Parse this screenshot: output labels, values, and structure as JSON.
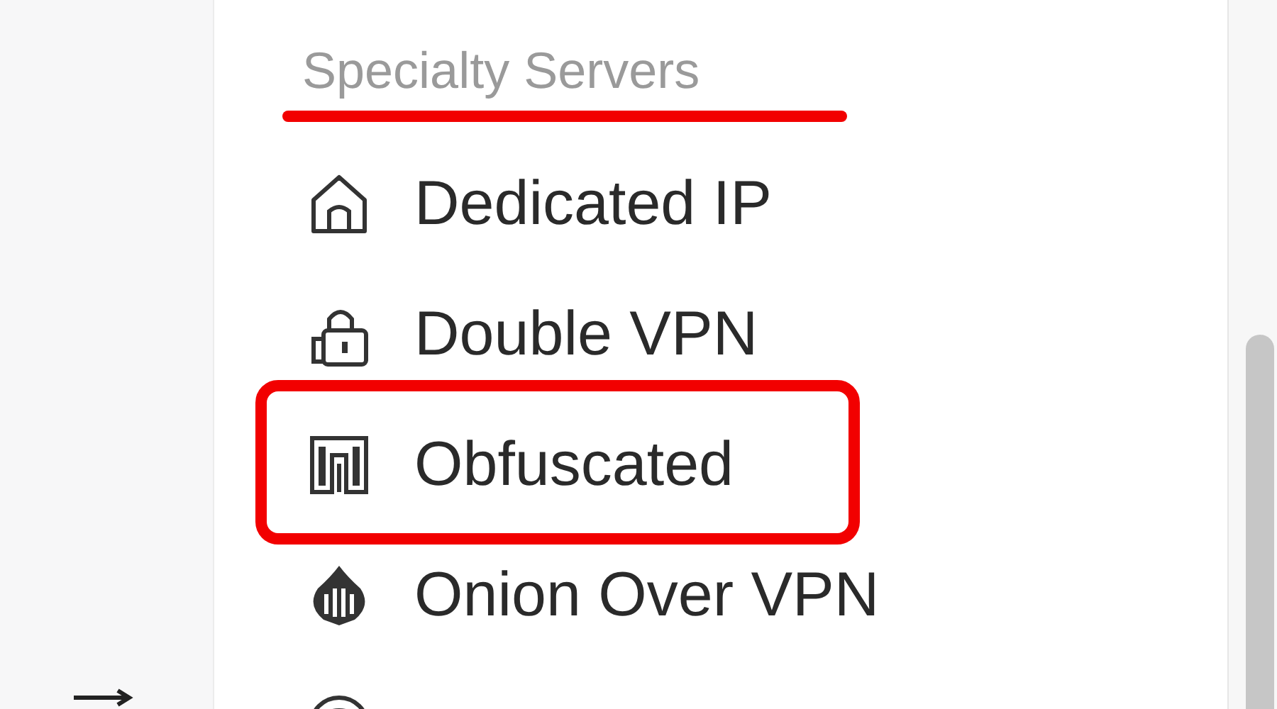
{
  "section": {
    "title": "Specialty Servers",
    "underlined": true
  },
  "items": [
    {
      "kind": "dedicated",
      "label": "Dedicated IP",
      "highlighted": false
    },
    {
      "kind": "double",
      "label": "Double VPN",
      "highlighted": false
    },
    {
      "kind": "obfuscated",
      "label": "Obfuscated",
      "highlighted": true
    },
    {
      "kind": "onion",
      "label": "Onion Over VPN",
      "highlighted": false
    },
    {
      "kind": "partial",
      "highlighted": false
    }
  ]
}
